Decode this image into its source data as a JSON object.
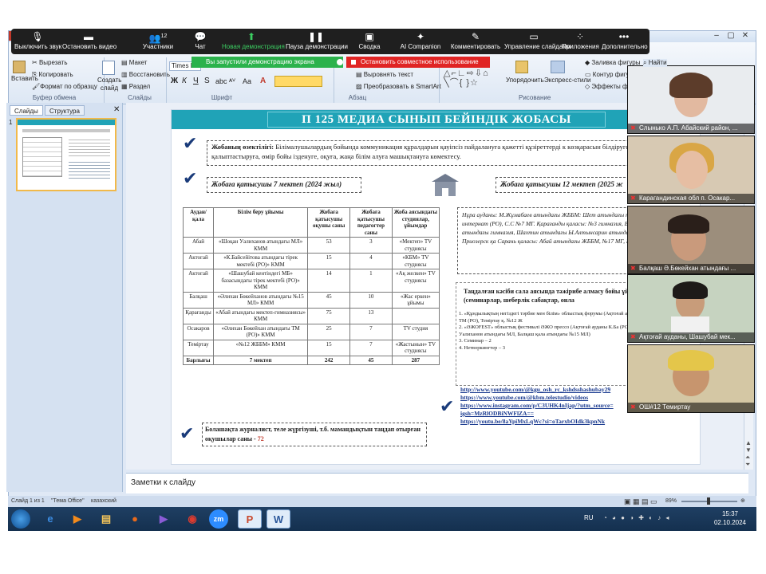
{
  "zoom_toolbar": {
    "items": [
      {
        "label": "Выключить звук",
        "icon": "microphone-icon"
      },
      {
        "label": "Остановить видео",
        "icon": "video-camera-icon"
      },
      {
        "label": "Участники",
        "icon": "participants-icon",
        "count": "12"
      },
      {
        "label": "Чат",
        "icon": "chat-icon"
      },
      {
        "label": "Новая демонстрация",
        "icon": "share-screen-icon"
      },
      {
        "label": "Пауза демонстрации",
        "icon": "pause-icon"
      },
      {
        "label": "Сводка",
        "icon": "summary-icon"
      },
      {
        "label": "AI Companion",
        "icon": "ai-sparkle-icon"
      },
      {
        "label": "Комментировать",
        "icon": "annotate-icon"
      },
      {
        "label": "Управление слайдами",
        "icon": "slides-icon"
      },
      {
        "label": "Приложения",
        "icon": "apps-icon"
      },
      {
        "label": "Дополнительно",
        "icon": "more-icon"
      }
    ],
    "share_banner": "Вы запустили демонстрацию экрана",
    "stop_banner": "Остановить совместное использование"
  },
  "ribbon": {
    "clipboard": {
      "paste": "Вставить",
      "cut": "Вырезать",
      "copy": "Копировать",
      "format": "Формат по образцу",
      "group": "Буфер обмена"
    },
    "slides": {
      "new_slide": "Создать слайд",
      "layout": "Макет",
      "reset": "Восстановить",
      "section": "Раздел",
      "group": "Слайды"
    },
    "font": {
      "name": "Times N",
      "group": "Шрифт"
    },
    "paragraph": {
      "align_text": "Выровнять текст",
      "smartart": "Преобразовать в SmartArt",
      "group": "Абзац"
    },
    "drawing": {
      "arrange": "Упорядочить",
      "styles": "Экспресс-стили",
      "fill": "Заливка фигуры",
      "outline": "Контур фигуры",
      "effects": "Эффекты фигур",
      "find": "Найти",
      "group": "Рисование"
    }
  },
  "side_panel": {
    "tab_slides": "Слайды",
    "tab_outline": "Структура",
    "slide_number": "1"
  },
  "slide": {
    "title": "П 125 МЕДИА СЫНЫП БЕЙІНДІК ЖОБАСЫ",
    "feature_label": "Жобаның өзектілігі:",
    "feature_text": "Білімалушылардың бойында коммуникация құралдарын қауіпсіз пайдалануға қажетті құзіреттерді к көзқарасын білдіруге, жеке танымын қалыптастыруға, өмір бойы ізденуге, оқуға, жаңа білім алуға машықтануға көмектесу.",
    "participants_2024": "Жобаға қатысушы 7 мектеп (2024 жыл)",
    "participants_2025": "Жобаға қатысушы 12 мектеп (2025 ж",
    "table_headers": [
      "Аудан/ қала",
      "Білім беру ұйымы",
      "Жобаға қатысушы оқушы саны",
      "Жобаға қатысушы педагогтер саны",
      "Жоба аясындағы студиялар, ұйымдар"
    ],
    "table_rows": [
      [
        "Абай",
        "«Шоқан Уалиханов атындағы МЛ» КММ",
        "53",
        "3",
        "«Мектеп» TV студиясы"
      ],
      [
        "Актогай",
        "«К.Байсейітова атындағы тірек мектебі (РО)» КММ",
        "15",
        "4",
        "«КБМ» TV студиясы"
      ],
      [
        "Актогай",
        "«Шашубай кентіндегі МБ» базасындағы тірек мектебі (РО)» КММ",
        "14",
        "1",
        "«Ақ желкен» TV студиясы"
      ],
      [
        "Балқаш",
        "«Әлихан Бөкейханов атындағы №15 МЛ» КММ",
        "45",
        "10",
        "«Жас еркен» ұйымы"
      ],
      [
        "Қарағанды",
        "«Абай атындағы мектеп-гимназиясы» КММ",
        "75",
        "13",
        ""
      ],
      [
        "Осакаров",
        "«Әлихан Бөкейхан атындағы ТМ (РО)» КММ",
        "25",
        "7",
        "TV студия"
      ],
      [
        "Теміртау",
        "«№12 ЖББМ» КММ",
        "15",
        "7",
        "«Жастынын» TV студиясы"
      ],
      [
        "Барлығы",
        "7 мектеп",
        "242",
        "45",
        "287"
      ]
    ],
    "schools_2025": "Нұра ауданы: М.Жұмабаев атындағы ЖББМ: Шет атындағы тірек мектеп жанындағы интернат (РО), С.С №7 МГ. Қарағанды қаласы: №3 гимназия, Б.Момышұлы М.Жұмабаев атындағы гимназия, Шахтин атындағы Ы.Алтынсарин атындағы мектеп-лицей. Приозерск қа Сарань қаласы: Абай атындағы ЖББМ, №17 МГ, БИЛ №1",
    "choice_text": "Болашақта журналист, теле жүргізуші, т.б. мамандықтын таңдап отырған оқушылар саны - ",
    "choice_count": "72",
    "exchange_title": "Таңдалған кәсіби сала аясында тәжірибе алмасу бойы ұйымдастыру (семинарлар, шеберлік сабақтар, онла",
    "exchange_items": [
      "1. «Құндылықтың негіздегі тәрбие мен білім» облыстық форумы (Ақтоғай ауданы К.Байсейітова атындағы ТМ (РО), Теміртау қ. №12 Ж",
      "2. «ӘЖОFEST» облыстық фестивалі ӘЖО прессо (Ақтоғай ауданы К.Ба (РО), Абай ауданы Шоқан Уалиханов атындағы МЛ, Балқаш қала атындағы №15 МЛ)",
      "3. Семинар – 2",
      "4. Нетворкингтер – 3"
    ],
    "links": [
      "http://www.youtube.com/@kgu_osh_rc_kshdsshashubay29",
      "https://www.youtube.com/@kbm.telestudio/videos",
      "https://www.instagram.com/p/C3UHK4nIjap/?utm_source=",
      "igsh=MzRlODBiNWFlZA==",
      "https://youtu.be/8aYpiMxLqWc?si=oTarxbOIdk3kpnNk"
    ]
  },
  "notes_placeholder": "Заметки к слайду",
  "status_bar": {
    "slide": "Слайд 1 из 1",
    "theme": "\"Тема Office\"",
    "lang": "казахский",
    "zoom": "89%"
  },
  "participants": [
    {
      "name": "Слынько А.П. Абайский район, ..."
    },
    {
      "name": "Карагандинская обл п. Осакар..."
    },
    {
      "name": "Балқаш Ә.Бөкейхан атындағы ..."
    },
    {
      "name": "Ақтоғай ауданы, Шашубай мек..."
    },
    {
      "name": "ОШ#12 Темиртау"
    }
  ],
  "taskbar": {
    "lang": "RU",
    "time": "15:37",
    "date": "02.10.2024"
  },
  "colors": {
    "title_bar": "#20a3b7",
    "zoom_bg": "#1f1f1f",
    "share_green": "#2bb24c",
    "stop_red": "#e02424",
    "check_blue": "#1a3b7a"
  }
}
